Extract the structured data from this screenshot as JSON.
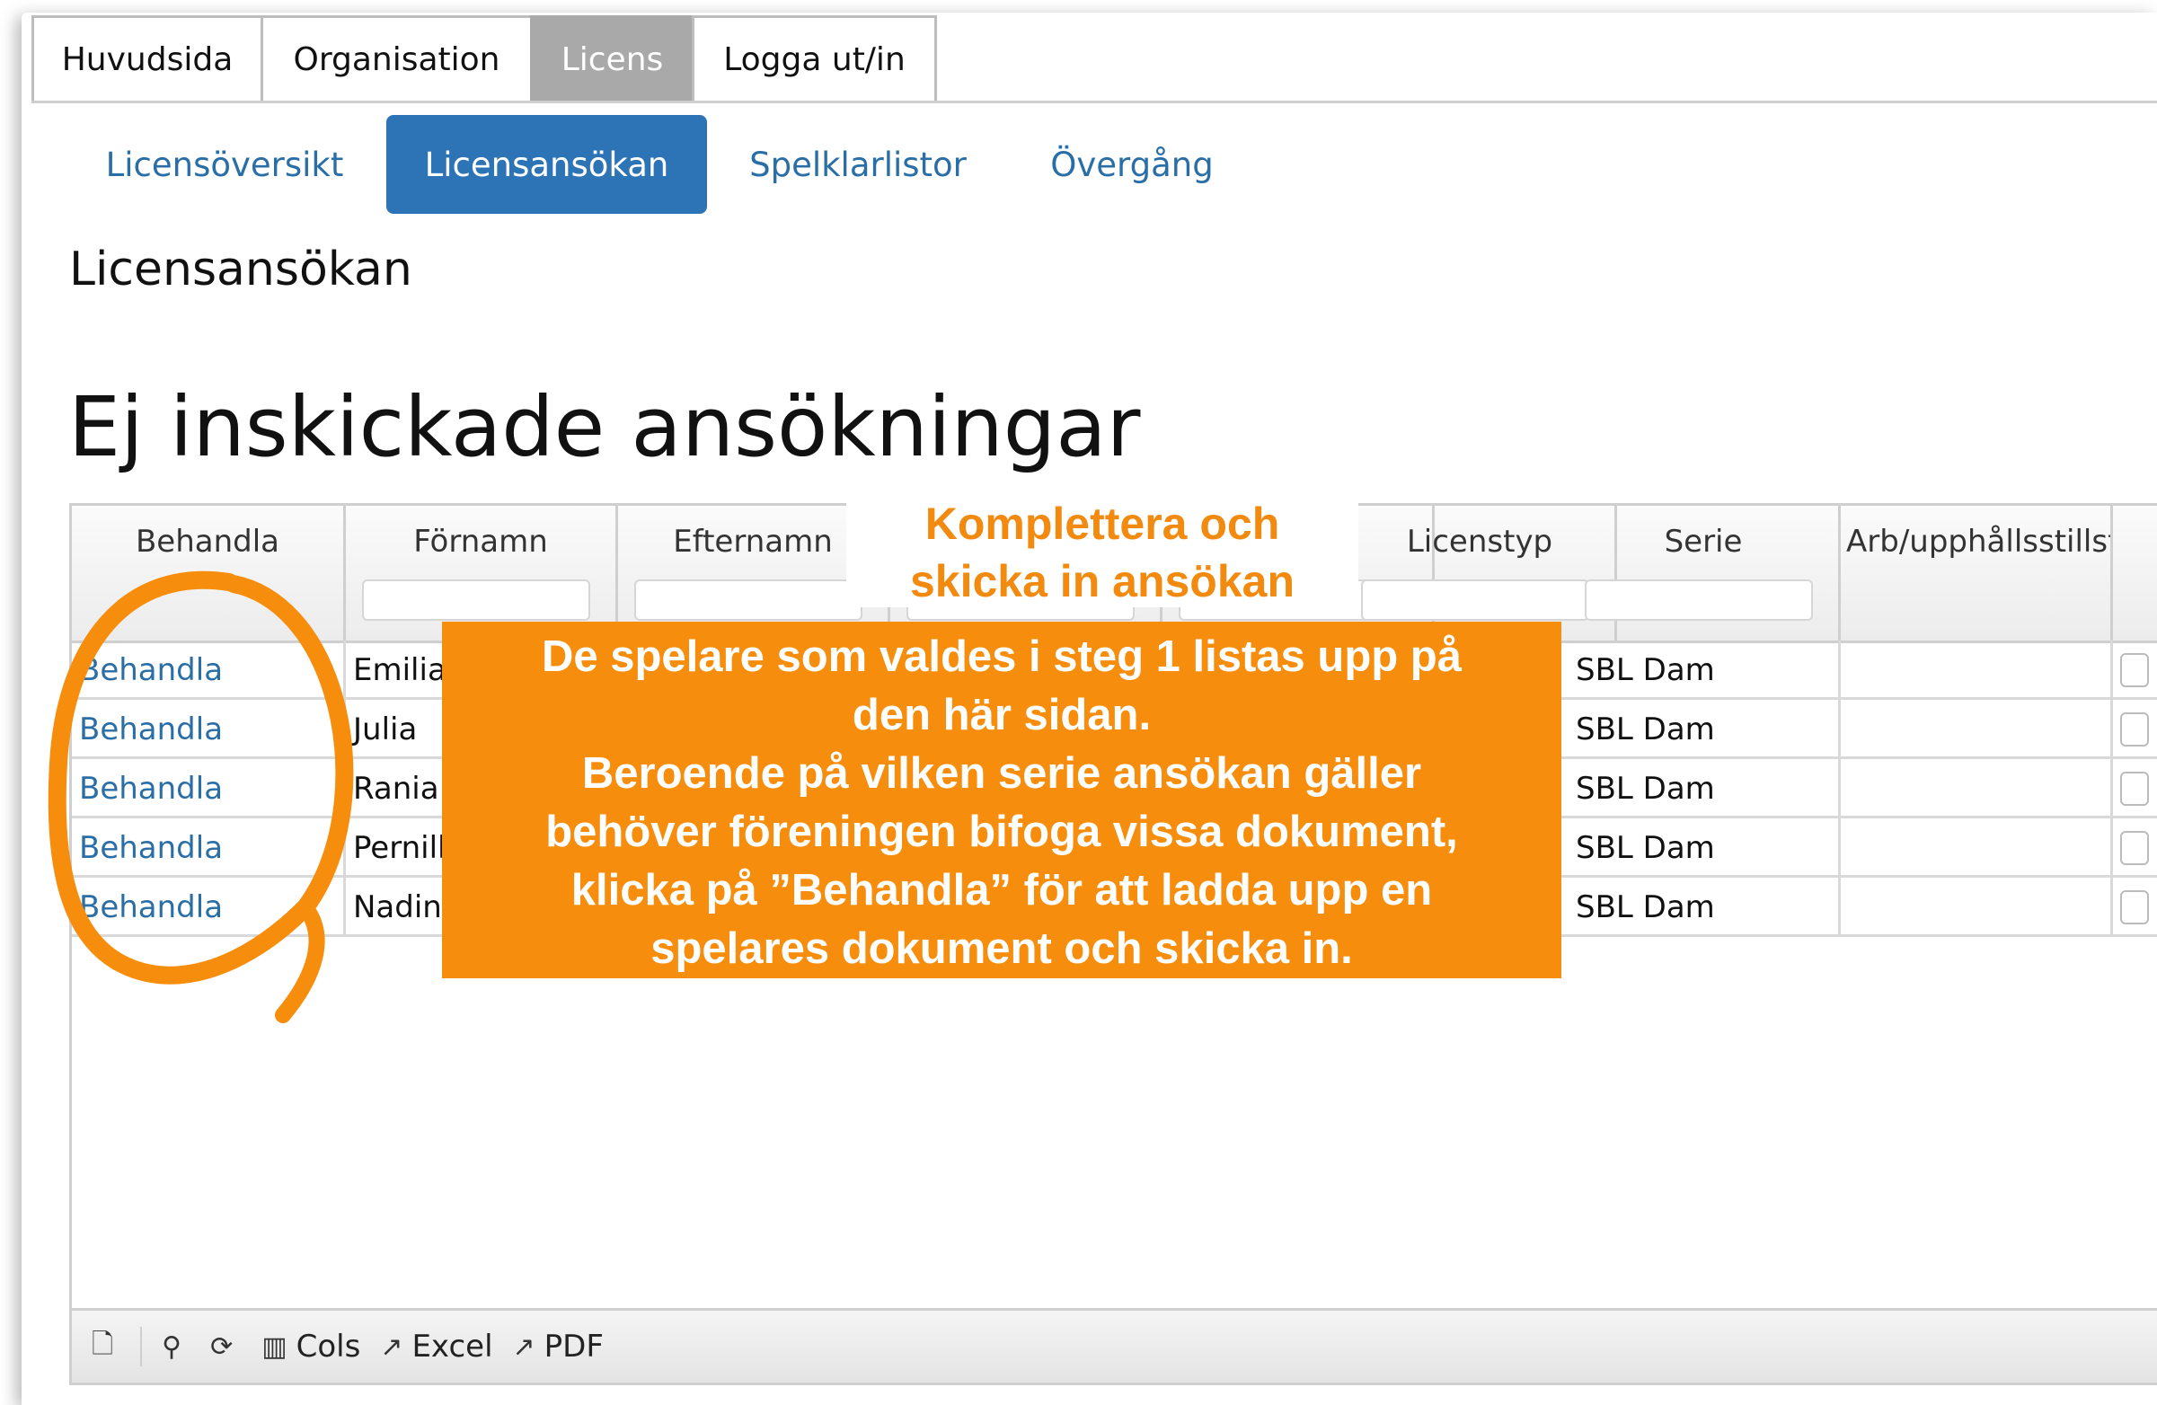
{
  "top_nav": [
    "Huvudsida",
    "Organisation",
    "Licens",
    "Logga ut/in"
  ],
  "sub_nav": [
    "Licensöversikt",
    "Licensansökan",
    "Spelklarlistor",
    "Övergång"
  ],
  "page_title": "Licensansökan",
  "section_title": "Ej inskickade ansökningar",
  "grid": {
    "columns": [
      "Behandla",
      "Förnamn",
      "Efternamn",
      "",
      "",
      "Licenstyp",
      "Serie",
      "Arb/upphållsstillst"
    ],
    "rows": [
      {
        "action": "Behandla",
        "first_name": "Emilia",
        "serie": "SBL Dam"
      },
      {
        "action": "Behandla",
        "first_name": "Julia",
        "serie": "SBL Dam"
      },
      {
        "action": "Behandla",
        "first_name": "Rania",
        "serie": "SBL Dam"
      },
      {
        "action": "Behandla",
        "first_name": "Pernill",
        "serie": "SBL Dam"
      },
      {
        "action": "Behandla",
        "first_name": "Nadine",
        "serie": "SBL Dam"
      }
    ]
  },
  "footer": {
    "cols": "Cols",
    "excel": "Excel",
    "pdf": "PDF"
  },
  "annotation_title": [
    "Komplettera och",
    "skicka in ansökan"
  ],
  "annotation_body": [
    "De spelare som valdes i steg 1 listas upp på",
    "den här sidan.",
    "Beroende på vilken serie ansökan gäller",
    "behöver föreningen bifoga vissa dokument,",
    "klicka på ”Behandla” för att ladda upp en",
    "spelares dokument och skicka in."
  ],
  "colors": {
    "link": "#2a6ea8",
    "active_subtab": "#2d74b6",
    "annotation": "#f78d0c"
  },
  "icons": [
    "new-icon",
    "search-icon",
    "refresh-icon",
    "columns-icon",
    "export-icon"
  ]
}
